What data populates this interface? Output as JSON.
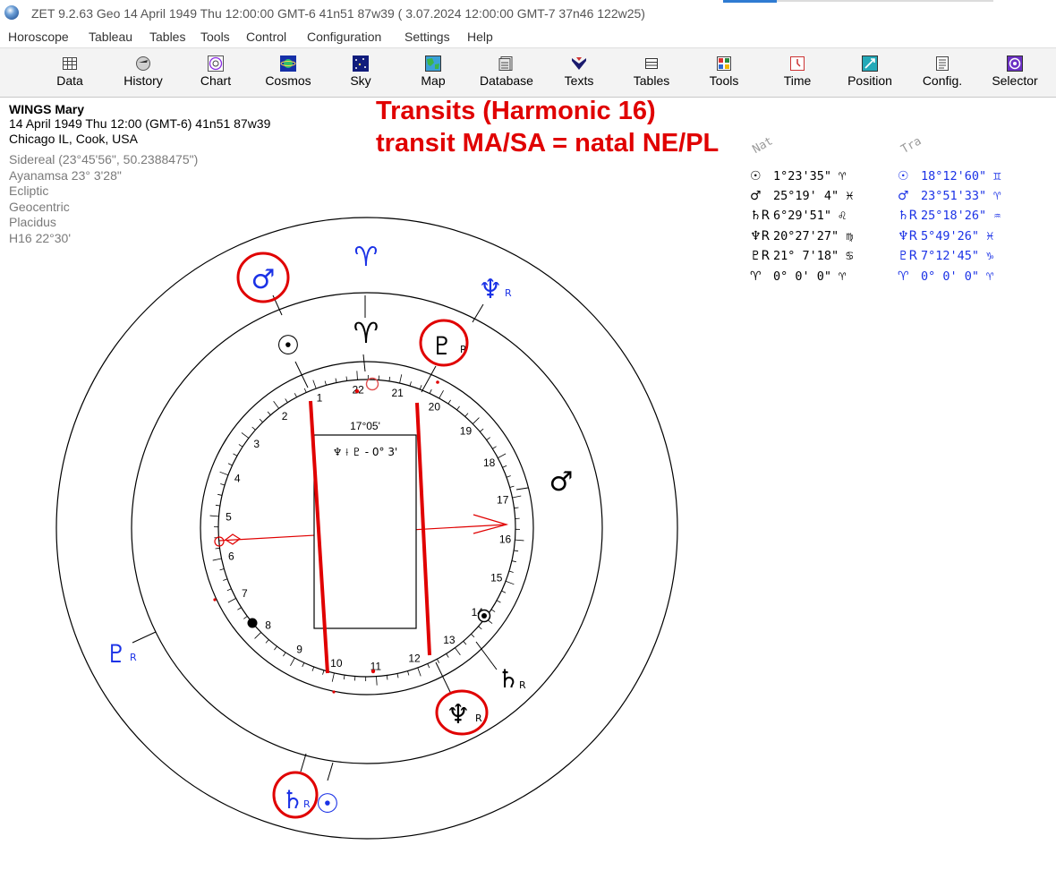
{
  "window": {
    "title": "ZET 9.2.63 Geo   14 April 1949  Thu  12:00:00 GMT-6 41n51  87w39  ( 3.07.2024  12:00:00 GMT-7 37n46 122w25)"
  },
  "menu": [
    "Horoscope",
    "Tableau",
    "Tables",
    "Tools",
    "Control",
    "Configuration",
    "Settings",
    "Help"
  ],
  "toolbar": [
    {
      "label": "Data",
      "icon": "data-grid-icon"
    },
    {
      "label": "History",
      "icon": "history-icon"
    },
    {
      "label": "Chart",
      "icon": "chart-wheel-icon"
    },
    {
      "label": "Cosmos",
      "icon": "cosmos-icon"
    },
    {
      "label": "Sky",
      "icon": "sky-icon"
    },
    {
      "label": "Map",
      "icon": "map-icon"
    },
    {
      "label": "Database",
      "icon": "database-icon"
    },
    {
      "label": "Texts",
      "icon": "texts-icon"
    },
    {
      "label": "Tables",
      "icon": "tables-icon"
    },
    {
      "label": "Tools",
      "icon": "tools-icon"
    },
    {
      "label": "Time",
      "icon": "time-icon"
    },
    {
      "label": "Position",
      "icon": "position-icon"
    },
    {
      "label": "Config.",
      "icon": "config-icon"
    },
    {
      "label": "Selector",
      "icon": "selector-icon"
    }
  ],
  "chart_info": {
    "name": "WINGS Mary",
    "line1": "14 April 1949  Thu  12:00 (GMT-6) 41n51  87w39",
    "line2": "Chicago IL, Cook, USA",
    "settings": [
      "Sidereal (23°45'56\", 50.2388475\")",
      "Ayanamsa 23° 3'28\"",
      "Ecliptic",
      "Geocentric",
      "Placidus",
      "H16  22°30'"
    ]
  },
  "annotation": {
    "line1": "Transits (Harmonic 16)",
    "line2": "transit MA/SA = natal NE/PL"
  },
  "colors": {
    "natal": "#000000",
    "transit": "#1b32e6",
    "annotation": "#e00000"
  },
  "positions": {
    "natal_header": "Nat",
    "transit_header": "Tra",
    "natal": [
      {
        "glyph": "☉",
        "value": "1°23'35\" ♈"
      },
      {
        "glyph": "♂",
        "value": "25°19' 4\" ♓"
      },
      {
        "glyph": "♄R",
        "value": "6°29'51\" ♌"
      },
      {
        "glyph": "♆R",
        "value": "20°27'27\" ♍"
      },
      {
        "glyph": "♇R",
        "value": "21° 7'18\" ♋"
      },
      {
        "glyph": "♈",
        "value": "0° 0' 0\" ♈"
      }
    ],
    "transit": [
      {
        "glyph": "☉",
        "value": "18°12'60\" ♊"
      },
      {
        "glyph": "♂",
        "value": "23°51'33\" ♈"
      },
      {
        "glyph": "♄R",
        "value": "25°18'26\" ♒"
      },
      {
        "glyph": "♆R",
        "value": "5°49'26\" ♓"
      },
      {
        "glyph": "♇R",
        "value": "7°12'45\" ♑"
      },
      {
        "glyph": "♈",
        "value": "0° 0' 0\" ♈"
      }
    ]
  },
  "wheel": {
    "center_box_value": "17°05'",
    "center_box_aspect": "♆ ⟊ ♇  - 0° 3'",
    "dial_numbers": [
      "1",
      "2",
      "3",
      "4",
      "5",
      "6",
      "7",
      "8",
      "9",
      "10",
      "11",
      "12",
      "13",
      "14",
      "15",
      "16",
      "17",
      "18",
      "19",
      "20",
      "21",
      "22"
    ],
    "natal_glyphs": [
      {
        "label": "♂",
        "colour": "#000000"
      },
      {
        "label": "☉",
        "colour": "#000000"
      },
      {
        "label": "♈",
        "colour": "#000000"
      },
      {
        "label": "♇",
        "r": "R",
        "colour": "#000000"
      },
      {
        "label": "♄",
        "r": "R",
        "colour": "#000000"
      },
      {
        "label": "♆",
        "r": "R",
        "colour": "#000000"
      }
    ],
    "transit_glyphs": [
      {
        "label": "♂",
        "colour": "#1b32e6"
      },
      {
        "label": "♈",
        "colour": "#1b32e6"
      },
      {
        "label": "♆",
        "r": "R",
        "colour": "#1b32e6"
      },
      {
        "label": "♇",
        "r": "R",
        "colour": "#1b32e6"
      },
      {
        "label": "♄",
        "r": "R",
        "colour": "#1b32e6"
      },
      {
        "label": "☉",
        "colour": "#1b32e6"
      }
    ]
  }
}
